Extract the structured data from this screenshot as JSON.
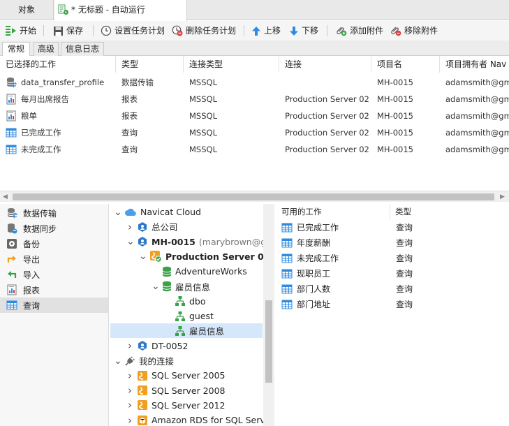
{
  "tabs": {
    "objects": "对象",
    "untitled": "* 无标题 - 自动运行"
  },
  "toolbar": {
    "start": "开始",
    "save": "保存",
    "set_schedule": "设置任务计划",
    "delete_schedule": "删除任务计划",
    "move_up": "上移",
    "move_down": "下移",
    "add_attachment": "添加附件",
    "remove_attachment": "移除附件"
  },
  "subtabs": {
    "general": "常规",
    "advanced": "高级",
    "log": "信息日志"
  },
  "jobs": {
    "headers": {
      "job": "已选择的工作",
      "type": "类型",
      "conn_type": "连接类型",
      "conn": "连接",
      "project": "项目名",
      "owner": "项目拥有者 Nav"
    },
    "rows": [
      {
        "name": "data_transfer_profile",
        "type": "数据传输",
        "conn_type": "MSSQL",
        "conn": "",
        "project": "MH-0015",
        "owner": "adamsmith@gma",
        "icon": "data-transfer-icon"
      },
      {
        "name": "每月出席报告",
        "type": "报表",
        "conn_type": "MSSQL",
        "conn": "Production Server 02",
        "project": "MH-0015",
        "owner": "adamsmith@gma",
        "icon": "report-icon"
      },
      {
        "name": "粮单",
        "type": "报表",
        "conn_type": "MSSQL",
        "conn": "Production Server 02",
        "project": "MH-0015",
        "owner": "adamsmith@gma",
        "icon": "report-icon"
      },
      {
        "name": "已完成工作",
        "type": "查询",
        "conn_type": "MSSQL",
        "conn": "Production Server 02",
        "project": "MH-0015",
        "owner": "adamsmith@gma",
        "icon": "query-icon"
      },
      {
        "name": "未完成工作",
        "type": "查询",
        "conn_type": "MSSQL",
        "conn": "Production Server 02",
        "project": "MH-0015",
        "owner": "adamsmith@gma",
        "icon": "query-icon"
      }
    ]
  },
  "categories": [
    {
      "label": "数据传输",
      "icon": "data-transfer-icon"
    },
    {
      "label": "数据同步",
      "icon": "data-sync-icon"
    },
    {
      "label": "备份",
      "icon": "backup-icon"
    },
    {
      "label": "导出",
      "icon": "export-icon"
    },
    {
      "label": "导入",
      "icon": "import-icon"
    },
    {
      "label": "报表",
      "icon": "report-icon"
    },
    {
      "label": "查询",
      "icon": "query-icon",
      "selected": true
    }
  ],
  "tree": [
    {
      "label": "Navicat Cloud",
      "level": 0,
      "arrow": "down",
      "icon": "cloud-icon"
    },
    {
      "label": "总公司",
      "level": 1,
      "arrow": "right",
      "icon": "project-icon"
    },
    {
      "label": "MH-0015",
      "suffix": " (marybrown@gma",
      "level": 1,
      "arrow": "down",
      "icon": "project-icon",
      "bold": true
    },
    {
      "label": "Production Server 02",
      "level": 2,
      "arrow": "down",
      "icon": "sqlserver-connected-icon",
      "bold": true
    },
    {
      "label": "AdventureWorks",
      "level": 3,
      "arrow": "",
      "icon": "database-icon"
    },
    {
      "label": "雇员信息",
      "level": 3,
      "arrow": "down",
      "icon": "database-icon"
    },
    {
      "label": "dbo",
      "level": 4,
      "arrow": "",
      "icon": "schema-icon"
    },
    {
      "label": "guest",
      "level": 4,
      "arrow": "",
      "icon": "schema-icon"
    },
    {
      "label": "雇员信息",
      "level": 4,
      "arrow": "",
      "icon": "schema-icon",
      "selected": true
    },
    {
      "label": "DT-0052",
      "level": 1,
      "arrow": "right",
      "icon": "project-icon"
    },
    {
      "label": "我的连接",
      "level": 0,
      "arrow": "down",
      "icon": "plug-icon"
    },
    {
      "label": "SQL Server 2005",
      "level": 1,
      "arrow": "right",
      "icon": "sqlserver-icon"
    },
    {
      "label": "SQL Server 2008",
      "level": 1,
      "arrow": "right",
      "icon": "sqlserver-icon"
    },
    {
      "label": "SQL Server 2012",
      "level": 1,
      "arrow": "right",
      "icon": "sqlserver-icon"
    },
    {
      "label": "Amazon RDS for SQL Server",
      "level": 1,
      "arrow": "right",
      "icon": "amazon-rds-icon"
    }
  ],
  "available": {
    "headers": {
      "job": "可用的工作",
      "type": "类型"
    },
    "rows": [
      {
        "name": "已完成工作",
        "type": "查询"
      },
      {
        "name": "年度薪酬",
        "type": "查询"
      },
      {
        "name": "未完成工作",
        "type": "查询"
      },
      {
        "name": "现职员工",
        "type": "查询"
      },
      {
        "name": "部门人数",
        "type": "查询"
      },
      {
        "name": "部门地址",
        "type": "查询"
      }
    ]
  },
  "colors": {
    "accent": "#2f8be0",
    "green": "#3aa34a",
    "red": "#d94040",
    "orange": "#f0a020",
    "selection": "#d5e7fb"
  }
}
